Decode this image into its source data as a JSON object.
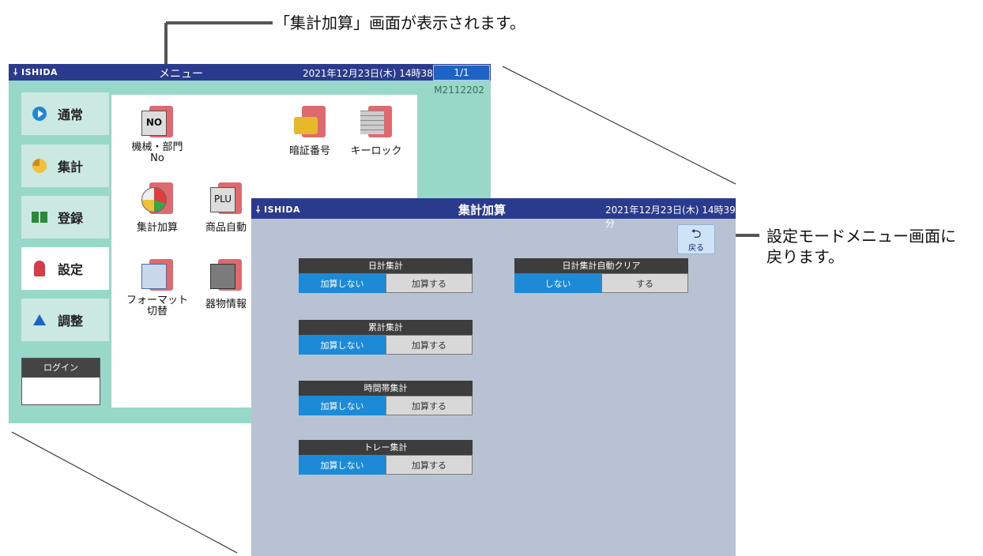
{
  "annotations": {
    "top_caption": "「集計加算」画面が表示されます。",
    "right_caption_line1": "設定モードメニュー画面に",
    "right_caption_line2": "戻ります。"
  },
  "menu_screen": {
    "logo": "ISHIDA",
    "title": "メニュー",
    "datetime": "2021年12月23日(木) 14時38分",
    "page": "1/1",
    "model_no": "M2112202",
    "categories": [
      {
        "label": "通常",
        "icon": "play-icon"
      },
      {
        "label": "集計",
        "icon": "pie-icon"
      },
      {
        "label": "登録",
        "icon": "book-icon"
      },
      {
        "label": "設定",
        "icon": "wrench-icon"
      },
      {
        "label": "調整",
        "icon": "scale-icon"
      }
    ],
    "login_label": "ログイン",
    "tiles": {
      "machine_dept": "機械・部門\nNo",
      "pin": "暗証番号",
      "key_lock": "キーロック",
      "total_add": "集計加算",
      "product_auto": "商品自動",
      "format_switch": "フォーマット\n切替",
      "device_info": "器物情報"
    }
  },
  "sum_screen": {
    "logo": "ISHIDA",
    "title": "集計加算",
    "datetime": "2021年12月23日(木) 14時39分",
    "back_label": "戻る",
    "groups": [
      {
        "title": "日計集計",
        "options": [
          "加算しない",
          "加算する"
        ],
        "selected": 0
      },
      {
        "title": "累計集計",
        "options": [
          "加算しない",
          "加算する"
        ],
        "selected": 0
      },
      {
        "title": "時間帯集計",
        "options": [
          "加算しない",
          "加算する"
        ],
        "selected": 0
      },
      {
        "title": "トレー集計",
        "options": [
          "加算しない",
          "加算する"
        ],
        "selected": 0
      },
      {
        "title": "日計集計自動クリア",
        "options": [
          "しない",
          "する"
        ],
        "selected": 0
      }
    ]
  },
  "colors": {
    "header": "#2a3b8e",
    "menu_bg": "#98d8c8",
    "sum_bg": "#b9c2d2",
    "selected": "#1d8ad8",
    "tile_red": "#de6a6f"
  }
}
